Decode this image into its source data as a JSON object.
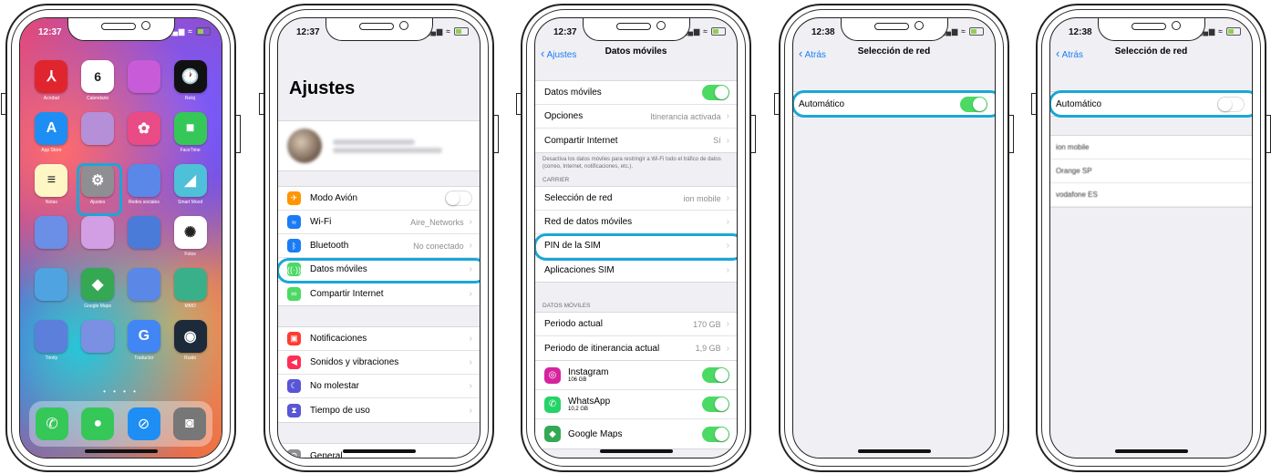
{
  "colors": {
    "ios_blue": "#1a7cf6",
    "toggle_on": "#4cd964",
    "highlight": "#1aa7d6"
  },
  "phone1": {
    "time": "12:37",
    "apps": [
      {
        "label": "Acrobat",
        "icon": "acrobat-icon",
        "color": "#e0252e",
        "glyph": "⅄"
      },
      {
        "label": "Calendario",
        "icon": "calendar-icon",
        "color": "#ffffff",
        "glyph": "6",
        "month": "Martes"
      },
      {
        "label": "",
        "icon": "folder-icon",
        "color": "#c85bd8",
        "glyph": ""
      },
      {
        "label": "Reloj",
        "icon": "clock-icon",
        "color": "#111111",
        "glyph": "🕐"
      },
      {
        "label": "App Store",
        "icon": "app-store-icon",
        "color": "#1e8ef5",
        "glyph": "A"
      },
      {
        "label": "",
        "icon": "folder-icon",
        "color": "#b58fd8",
        "glyph": ""
      },
      {
        "label": "",
        "icon": "flower-icon",
        "color": "#e94b86",
        "glyph": "✿"
      },
      {
        "label": "FaceTime",
        "icon": "facetime-icon",
        "color": "#36c759",
        "glyph": "■"
      },
      {
        "label": "Notas",
        "icon": "notes-icon",
        "color": "#fff6c6",
        "glyph": "≡"
      },
      {
        "label": "Ajustes",
        "icon": "settings-icon",
        "color": "#8e8e93",
        "glyph": "⚙"
      },
      {
        "label": "Redes sociales",
        "icon": "folder-icon",
        "color": "#5a87e8",
        "glyph": ""
      },
      {
        "label": "Smart Mood",
        "icon": "maps-icon",
        "color": "#4ec0d8",
        "glyph": "◢"
      },
      {
        "label": "",
        "icon": "folder-icon",
        "color": "#6b8ee6",
        "glyph": ""
      },
      {
        "label": "",
        "icon": "folder-icon",
        "color": "#d29ee4",
        "glyph": ""
      },
      {
        "label": "",
        "icon": "folder-icon",
        "color": "#4b7bd9",
        "glyph": ""
      },
      {
        "label": "Fotos",
        "icon": "photos-icon",
        "color": "#ffffff",
        "glyph": "✺"
      },
      {
        "label": "",
        "icon": "folder-icon",
        "color": "#4fa3e0",
        "glyph": ""
      },
      {
        "label": "Google Maps",
        "icon": "google-maps-icon",
        "color": "#34a853",
        "glyph": "◆"
      },
      {
        "label": "",
        "icon": "folder-icon",
        "color": "#5b88e6",
        "glyph": ""
      },
      {
        "label": "MMO",
        "icon": "folder-icon",
        "color": "#3ab08a",
        "glyph": ""
      },
      {
        "label": "Trinity",
        "icon": "folder-icon",
        "color": "#5c7fdc",
        "glyph": ""
      },
      {
        "label": "",
        "icon": "folder-icon",
        "color": "#7b8fe3",
        "glyph": ""
      },
      {
        "label": "Traductor",
        "icon": "translate-icon",
        "color": "#4285f4",
        "glyph": "G"
      },
      {
        "label": "Ruido",
        "icon": "noise-icon",
        "color": "#1c2a3a",
        "glyph": "◉"
      }
    ],
    "dock": [
      {
        "icon": "phone-icon",
        "color": "#36c759",
        "glyph": "✆"
      },
      {
        "icon": "messages-icon",
        "color": "#36c759",
        "glyph": "●"
      },
      {
        "icon": "safari-icon",
        "color": "#1e8ef5",
        "glyph": "⊘"
      },
      {
        "icon": "camera-icon",
        "color": "#777",
        "glyph": "◙"
      }
    ]
  },
  "phone2": {
    "time": "12:37",
    "title": "Ajustes",
    "group1": [
      {
        "label": "Modo Avión",
        "icon": "airplane-icon",
        "color": "#ff9500",
        "glyph": "✈",
        "toggle": "off"
      },
      {
        "label": "Wi-Fi",
        "icon": "wifi-icon",
        "color": "#1a7cf6",
        "glyph": "≈",
        "value": "Aire_Networks"
      },
      {
        "label": "Bluetooth",
        "icon": "bluetooth-icon",
        "color": "#1a7cf6",
        "glyph": "ᛒ",
        "value": "No conectado"
      },
      {
        "label": "Datos móviles",
        "icon": "cellular-icon",
        "color": "#4cd964",
        "glyph": "((·))",
        "value": ""
      },
      {
        "label": "Compartir Internet",
        "icon": "hotspot-icon",
        "color": "#4cd964",
        "glyph": "∞",
        "value": ""
      }
    ],
    "group2": [
      {
        "label": "Notificaciones",
        "icon": "notifications-icon",
        "color": "#ff3b30",
        "glyph": "▣"
      },
      {
        "label": "Sonidos y vibraciones",
        "icon": "sounds-icon",
        "color": "#ff2d55",
        "glyph": "◀"
      },
      {
        "label": "No molestar",
        "icon": "moon-icon",
        "color": "#5856d6",
        "glyph": "☾"
      },
      {
        "label": "Tiempo de uso",
        "icon": "hourglass-icon",
        "color": "#5856d6",
        "glyph": "⧗"
      }
    ],
    "group3": [
      {
        "label": "General",
        "icon": "gear-icon",
        "color": "#8e8e93",
        "glyph": "⚙"
      }
    ]
  },
  "phone3": {
    "time": "12:37",
    "back": "Ajustes",
    "title": "Datos móviles",
    "group1": [
      {
        "label": "Datos móviles",
        "toggle": "on"
      },
      {
        "label": "Opciones",
        "value": "Itinerancia activada"
      },
      {
        "label": "Compartir Internet",
        "value": "Sí"
      }
    ],
    "note": "Desactiva los datos móviles para restringir a Wi-Fi todo el tráfico de datos (correo, Internet, notificaciones, etc.).",
    "carrier_header": "CARRIER",
    "group2": [
      {
        "label": "Selección de red",
        "value": "ion mobile"
      },
      {
        "label": "Red de datos móviles",
        "value": ""
      },
      {
        "label": "PIN de la SIM",
        "value": ""
      },
      {
        "label": "Aplicaciones SIM",
        "value": ""
      }
    ],
    "data_header": "DATOS MÓVILES",
    "group3": [
      {
        "label": "Periodo actual",
        "value": "170 GB"
      },
      {
        "label": "Periodo de itinerancia actual",
        "value": "1,9 GB"
      }
    ],
    "apps": [
      {
        "label": "Instagram",
        "size": "106 GB",
        "icon": "instagram-icon",
        "color": "#d6249f",
        "glyph": "◎"
      },
      {
        "label": "WhatsApp",
        "size": "10,2 GB",
        "icon": "whatsapp-icon",
        "color": "#25d366",
        "glyph": "✆"
      },
      {
        "label": "Google Maps",
        "size": "",
        "icon": "google-maps-icon",
        "color": "#34a853",
        "glyph": "◆"
      }
    ]
  },
  "phone4": {
    "time": "12:38",
    "back": "Atrás",
    "title": "Selección de red",
    "auto_label": "Automático"
  },
  "phone5": {
    "time": "12:38",
    "back": "Atrás",
    "title": "Selección de red",
    "auto_label": "Automático",
    "networks": [
      "ion mobile",
      "Orange SP",
      "vodafone ES"
    ]
  }
}
